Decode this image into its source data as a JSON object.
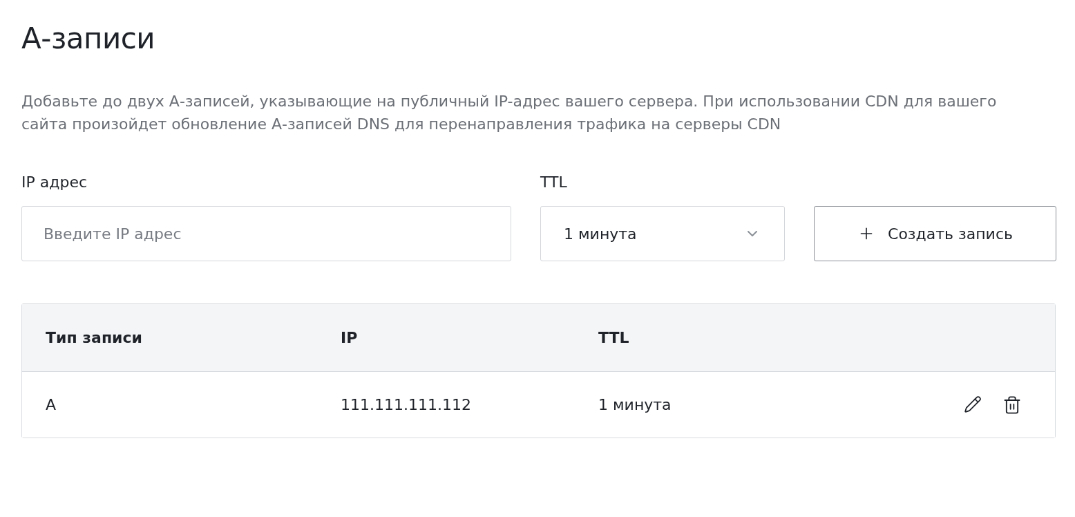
{
  "title": "А-записи",
  "description": "Добавьте до двух А-записей, указывающие на публичный IP-адрес вашего сервера. При использовании CDN для вашего сайта произойдет обновление А-записей DNS для перенаправления трафика на серверы CDN",
  "form": {
    "ip_label": "IP адрес",
    "ip_placeholder": "Введите IP адрес",
    "ttl_label": "TTL",
    "ttl_value": "1 минута",
    "create_button": "Создать запись"
  },
  "table": {
    "columns": [
      "Тип записи",
      "IP",
      "TTL"
    ],
    "rows": [
      {
        "type": "A",
        "ip": "111.111.111.112",
        "ttl": "1 минута"
      }
    ]
  }
}
